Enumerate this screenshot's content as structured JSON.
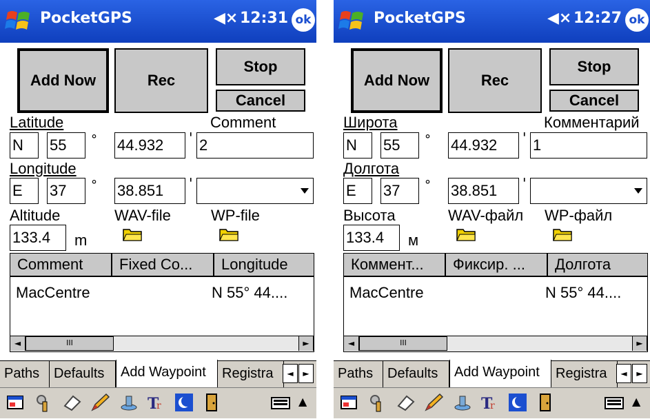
{
  "screens": [
    {
      "title": "PocketGPS",
      "time": "12:31",
      "ok": "ok",
      "buttons": {
        "add_now": "Add Now",
        "rec": "Rec",
        "stop": "Stop",
        "cancel": "Cancel"
      },
      "latitude_label": "Latitude",
      "comment_label": "Comment",
      "lat_dir": "N",
      "lat_deg": "55",
      "lat_min": "44.932",
      "comment_value": "2",
      "longitude_label": "Longitude",
      "lon_dir": "E",
      "lon_deg": "37",
      "lon_min": "38.851",
      "altitude_label": "Altitude",
      "altitude_value": "133.4",
      "altitude_unit": "m",
      "wav_label": "WAV-file",
      "wp_label": "WP-file",
      "columns": [
        "Comment",
        "Fixed Co...",
        "Longitude"
      ],
      "rows": [
        {
          "comment": "MacCentre",
          "longitude": "N 55° 44...."
        }
      ],
      "tabs": [
        "Paths",
        "Defaults",
        "Add Waypoint",
        "Registra"
      ]
    },
    {
      "title": "PocketGPS",
      "time": "12:27",
      "ok": "ok",
      "buttons": {
        "add_now": "Add Now",
        "rec": "Rec",
        "stop": "Stop",
        "cancel": "Cancel"
      },
      "latitude_label": "Широта",
      "comment_label": "Комментарий",
      "lat_dir": "N",
      "lat_deg": "55",
      "lat_min": "44.932",
      "comment_value": "1",
      "longitude_label": "Долгота",
      "lon_dir": "E",
      "lon_deg": "37",
      "lon_min": "38.851",
      "altitude_label": "Высота",
      "altitude_value": "133.4",
      "altitude_unit": "м",
      "wav_label": "WAV-файл",
      "wp_label": "WP-файл",
      "columns": [
        "Коммент...",
        "Фиксир. ...",
        "Долгота"
      ],
      "rows": [
        {
          "comment": "MacCentre",
          "longitude": "N 55° 44...."
        }
      ],
      "tabs": [
        "Paths",
        "Defaults",
        "Add Waypoint",
        "Registra"
      ]
    }
  ],
  "symbols": {
    "degree": "°",
    "minute": "'",
    "scroll_left": "◄",
    "scroll_right": "►",
    "scroll_thumb": "III",
    "up_arrow": "▲"
  },
  "icons": [
    "windows-start-icon",
    "speaker-muted-icon",
    "folder-icon",
    "window-icon",
    "tools-icon",
    "eraser-icon",
    "pencil-icon",
    "stamp-icon",
    "translate-icon",
    "globe-icon",
    "exit-door-icon",
    "keyboard-icon"
  ],
  "colors": {
    "titlebar": "#1b4fd0",
    "button_face": "#c8c8c8",
    "folder": "#f0d000"
  }
}
